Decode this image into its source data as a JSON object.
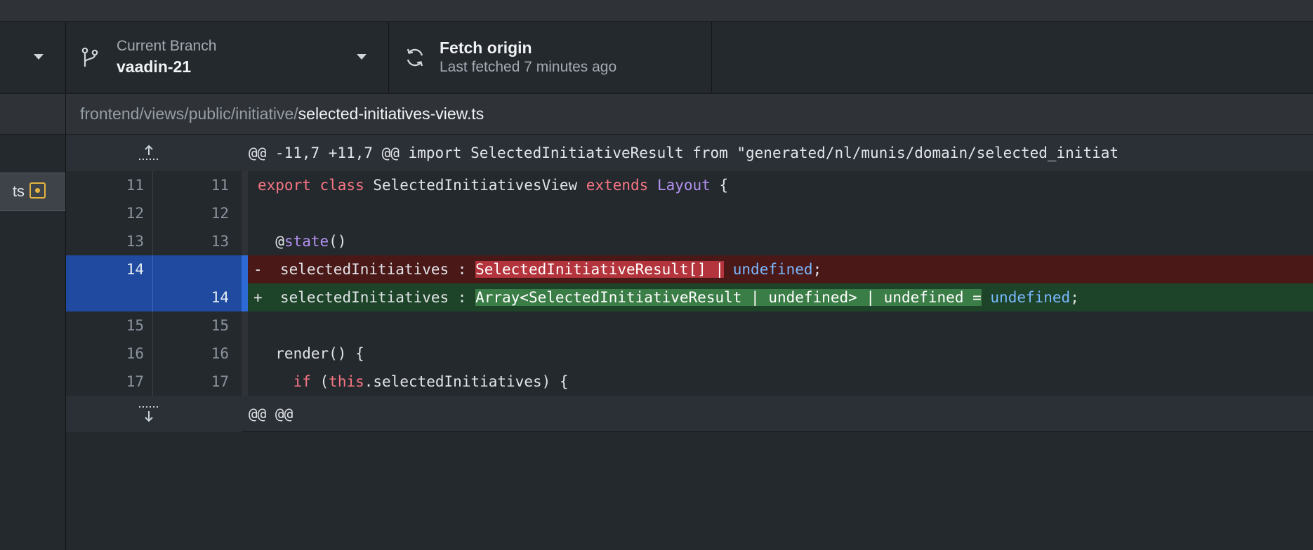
{
  "toolbar": {
    "current_branch_label": "Current Branch",
    "current_branch_value": "vaadin-21",
    "fetch_title": "Fetch origin",
    "fetch_subtitle": "Last fetched 7 minutes ago"
  },
  "sidebar": {
    "changed_file_label": "ts"
  },
  "file": {
    "dir": "frontend/views/public/initiative/",
    "name": "selected-initiatives-view.ts"
  },
  "diff": {
    "hunk_header": "@@ -11,7 +11,7 @@ import SelectedInitiativeResult from \"generated/nl/munis/domain/selected_initiat",
    "footer_header": "@@ @@",
    "lines": [
      {
        "old": "11",
        "new": "11",
        "type": "context",
        "segments": [
          {
            "t": "export class",
            "c": "kw"
          },
          {
            "t": " SelectedInitiativesView ",
            "c": ""
          },
          {
            "t": "extends",
            "c": "kw"
          },
          {
            "t": " ",
            "c": ""
          },
          {
            "t": "Layout",
            "c": "type"
          },
          {
            "t": " {",
            "c": ""
          }
        ]
      },
      {
        "old": "12",
        "new": "12",
        "type": "context",
        "segments": [
          {
            "t": "",
            "c": ""
          }
        ]
      },
      {
        "old": "13",
        "new": "13",
        "type": "context",
        "segments": [
          {
            "t": "  @",
            "c": ""
          },
          {
            "t": "state",
            "c": "type"
          },
          {
            "t": "()",
            "c": ""
          }
        ]
      },
      {
        "old": "14",
        "new": "",
        "type": "del",
        "marker": "-",
        "segments": [
          {
            "t": "  selectedInitiatives : ",
            "c": ""
          },
          {
            "t": "SelectedInitiativeResult[] |",
            "c": "hl-del"
          },
          {
            "t": " ",
            "c": ""
          },
          {
            "t": "undefined",
            "c": "const"
          },
          {
            "t": ";",
            "c": ""
          }
        ]
      },
      {
        "old": "",
        "new": "14",
        "type": "add",
        "marker": "+",
        "segments": [
          {
            "t": "  selectedInitiatives : ",
            "c": ""
          },
          {
            "t": "Array<SelectedInitiativeResult | undefined> | undefined =",
            "c": "hl-add"
          },
          {
            "t": " ",
            "c": ""
          },
          {
            "t": "undefined",
            "c": "const"
          },
          {
            "t": ";",
            "c": ""
          }
        ]
      },
      {
        "old": "15",
        "new": "15",
        "type": "context",
        "segments": [
          {
            "t": "",
            "c": ""
          }
        ]
      },
      {
        "old": "16",
        "new": "16",
        "type": "context",
        "segments": [
          {
            "t": "  render() {",
            "c": ""
          }
        ]
      },
      {
        "old": "17",
        "new": "17",
        "type": "context",
        "segments": [
          {
            "t": "    ",
            "c": ""
          },
          {
            "t": "if",
            "c": "kw"
          },
          {
            "t": " (",
            "c": ""
          },
          {
            "t": "this",
            "c": "kw"
          },
          {
            "t": ".selectedInitiatives) {",
            "c": ""
          }
        ]
      }
    ]
  },
  "icons": {
    "branch": "git-branch-icon",
    "fetch": "sync-icon",
    "expand_up": "expand-up-icon",
    "expand_down": "expand-down-icon",
    "modified": "file-modified-icon"
  }
}
